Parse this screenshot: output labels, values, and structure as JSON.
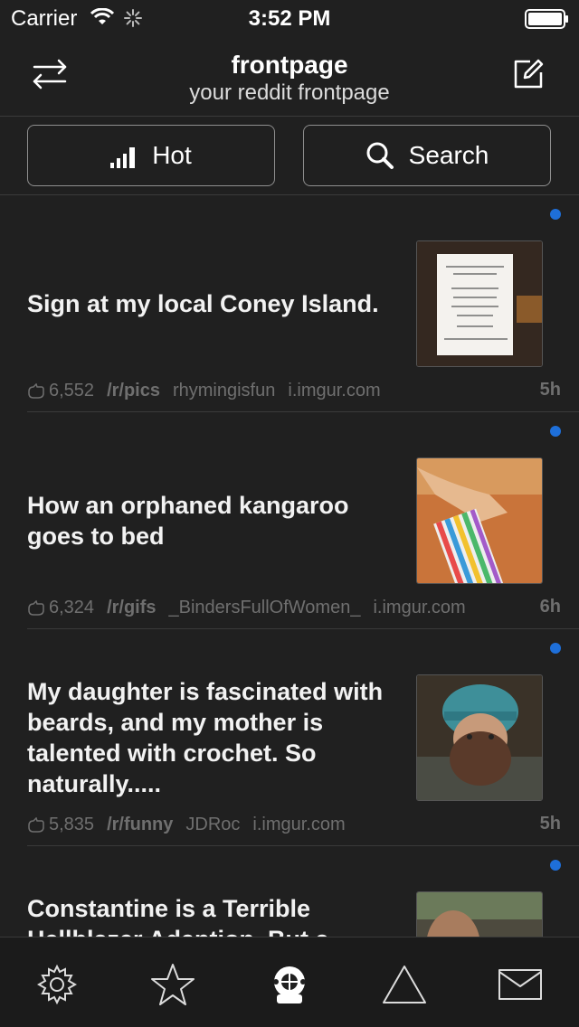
{
  "status_bar": {
    "carrier": "Carrier",
    "time": "3:52 PM"
  },
  "nav": {
    "title": "frontpage",
    "subtitle": "your reddit frontpage",
    "left_icon": "swap-arrows-icon",
    "right_icon": "compose-icon"
  },
  "segments": {
    "hot_label": "Hot",
    "search_label": "Search"
  },
  "posts": [
    {
      "title": "Sign at my local Coney Island.",
      "score": "6,552",
      "subreddit": "/r/pics",
      "author": "rhymingisfun",
      "domain": "i.imgur.com",
      "age": "5h"
    },
    {
      "title": "How an orphaned kangaroo goes to bed",
      "score": "6,324",
      "subreddit": "/r/gifs",
      "author": "_BindersFullOfWomen_",
      "domain": "i.imgur.com",
      "age": "6h"
    },
    {
      "title": "My daughter is fascinated with beards, and my mother is talented with crochet. So naturally.....",
      "score": "5,835",
      "subreddit": "/r/funny",
      "author": "JDRoc",
      "domain": "i.imgur.com",
      "age": "5h"
    },
    {
      "title": "Constantine is a Terrible Hellblazer Adaption. But a"
    }
  ],
  "tabs": [
    "settings-gear-icon",
    "star-icon",
    "diver-helmet-icon",
    "triangle-icon",
    "mail-icon"
  ],
  "colors": {
    "background": "#202020",
    "unread_dot": "#1e6fd9",
    "meta_text": "#6f6f6f"
  }
}
